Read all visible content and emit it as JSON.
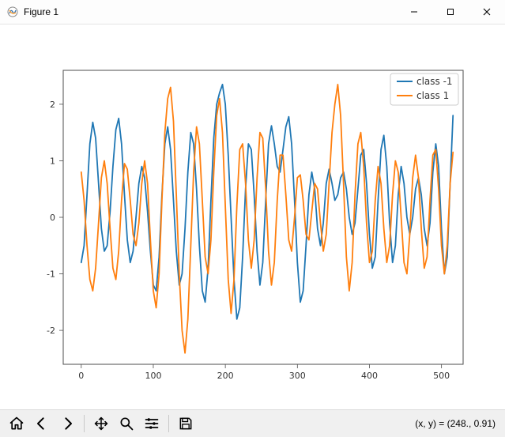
{
  "window": {
    "title": "Figure 1"
  },
  "toolbar": {
    "coord_text": "(x, y) = (248., 0.91)",
    "tooltips": {
      "home": "Home",
      "back": "Back",
      "forward": "Forward",
      "pan": "Pan",
      "zoom": "Zoom",
      "subplots": "Configure subplots",
      "save": "Save"
    }
  },
  "chart_data": {
    "type": "line",
    "xlabel": "",
    "ylabel": "",
    "title": "",
    "xlim": [
      -25,
      530
    ],
    "ylim": [
      -2.6,
      2.6
    ],
    "xticks": [
      0,
      100,
      200,
      300,
      400,
      500
    ],
    "yticks": [
      -2,
      -1,
      0,
      1,
      2
    ],
    "legend": {
      "position": "upper right",
      "entries": [
        "class -1",
        "class 1"
      ]
    },
    "colors": {
      "class -1": "#1f77b4",
      "class 1": "#ff7f0e"
    },
    "series": [
      {
        "name": "class -1",
        "color": "#1f77b4",
        "x_step": 4,
        "x_start": 0,
        "values": [
          -0.8,
          -0.5,
          0.4,
          1.3,
          1.68,
          1.4,
          0.6,
          -0.2,
          -0.6,
          -0.5,
          0.1,
          0.9,
          1.55,
          1.75,
          1.3,
          0.4,
          -0.4,
          -0.8,
          -0.6,
          0.0,
          0.6,
          0.9,
          0.7,
          0.1,
          -0.6,
          -1.2,
          -1.3,
          -0.7,
          0.4,
          1.3,
          1.6,
          1.2,
          0.3,
          -0.6,
          -1.2,
          -1.0,
          -0.2,
          0.8,
          1.5,
          1.3,
          0.5,
          -0.5,
          -1.3,
          -1.5,
          -0.9,
          0.3,
          1.4,
          2.0,
          2.2,
          2.35,
          2.0,
          1.1,
          0.0,
          -1.1,
          -1.8,
          -1.6,
          -0.7,
          0.5,
          1.3,
          1.2,
          0.4,
          -0.6,
          -1.2,
          -0.8,
          0.3,
          1.3,
          1.62,
          1.3,
          0.9,
          0.8,
          1.2,
          1.6,
          1.78,
          1.3,
          0.3,
          -0.8,
          -1.5,
          -1.3,
          -0.5,
          0.4,
          0.8,
          0.5,
          -0.2,
          -0.5,
          -0.1,
          0.6,
          0.85,
          0.6,
          0.3,
          0.4,
          0.7,
          0.8,
          0.5,
          0.0,
          -0.3,
          -0.1,
          0.5,
          1.1,
          1.2,
          0.6,
          -0.3,
          -0.9,
          -0.7,
          0.3,
          1.2,
          1.45,
          0.9,
          -0.1,
          -0.8,
          -0.5,
          0.4,
          0.9,
          0.6,
          0.0,
          -0.3,
          0.0,
          0.5,
          0.7,
          0.4,
          -0.2,
          -0.5,
          -0.1,
          0.8,
          1.3,
          0.9,
          -0.2,
          -1.0,
          -0.7,
          0.6,
          1.8
        ]
      },
      {
        "name": "class 1",
        "color": "#ff7f0e",
        "x_step": 4,
        "x_start": 0,
        "values": [
          0.8,
          0.3,
          -0.5,
          -1.1,
          -1.3,
          -0.9,
          -0.1,
          0.7,
          1.0,
          0.6,
          -0.2,
          -0.9,
          -1.1,
          -0.6,
          0.3,
          0.95,
          0.85,
          0.3,
          -0.3,
          -0.5,
          -0.1,
          0.6,
          1.0,
          0.6,
          -0.4,
          -1.3,
          -1.6,
          -1.0,
          0.3,
          1.5,
          2.1,
          2.3,
          1.7,
          0.4,
          -1.0,
          -2.0,
          -2.4,
          -1.8,
          -0.5,
          0.8,
          1.6,
          1.3,
          0.3,
          -0.7,
          -1.0,
          -0.4,
          0.8,
          1.8,
          2.1,
          1.5,
          0.2,
          -1.1,
          -1.7,
          -1.1,
          0.2,
          1.2,
          1.3,
          0.6,
          -0.4,
          -0.9,
          -0.4,
          0.7,
          1.5,
          1.4,
          0.5,
          -0.6,
          -1.2,
          -0.8,
          0.3,
          1.1,
          1.1,
          0.4,
          -0.4,
          -0.6,
          0.0,
          0.7,
          0.75,
          0.3,
          -0.3,
          -0.4,
          0.1,
          0.6,
          0.5,
          -0.1,
          -0.6,
          -0.3,
          0.6,
          1.5,
          2.0,
          2.35,
          1.8,
          0.6,
          -0.7,
          -1.3,
          -0.8,
          0.4,
          1.3,
          1.5,
          0.9,
          -0.1,
          -0.8,
          -0.6,
          0.3,
          0.9,
          0.6,
          -0.2,
          -0.8,
          -0.5,
          0.4,
          1.0,
          0.8,
          0.0,
          -0.8,
          -1.0,
          -0.3,
          0.7,
          1.1,
          0.7,
          -0.2,
          -0.9,
          -0.7,
          0.3,
          1.1,
          1.2,
          0.5,
          -0.5,
          -1.0,
          -0.5,
          0.6,
          1.15
        ]
      }
    ]
  }
}
